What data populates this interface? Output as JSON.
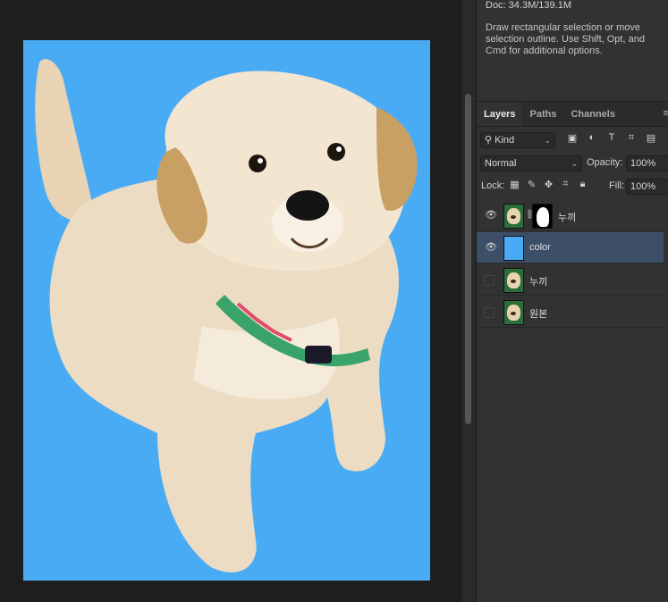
{
  "info": {
    "doc_size": "Doc: 34.3M/139.1M",
    "hint": "Draw rectangular selection or move selection outline.  Use Shift, Opt, and Cmd for additional options."
  },
  "layers_panel": {
    "tabs": [
      "Layers",
      "Paths",
      "Channels"
    ],
    "menu_icon": "≡",
    "filter": {
      "label": "Kind",
      "icons": [
        "image-filter-icon",
        "adjustment-filter-icon",
        "type-filter-icon",
        "shape-filter-icon",
        "smart-object-filter-icon"
      ]
    },
    "blend_mode": "Normal",
    "opacity_label": "Opacity:",
    "opacity_value": "100%",
    "lock_label": "Lock:",
    "fill_label": "Fill:",
    "fill_value": "100%",
    "layers": [
      {
        "name": "누끼",
        "visible": true,
        "has_mask": true,
        "selected": false,
        "thumb": "photo"
      },
      {
        "name": "color",
        "visible": true,
        "has_mask": false,
        "selected": true,
        "thumb": "color"
      },
      {
        "name": "누끼",
        "visible": false,
        "has_mask": false,
        "selected": false,
        "thumb": "photo"
      },
      {
        "name": "원본",
        "visible": false,
        "has_mask": false,
        "selected": false,
        "thumb": "photo"
      }
    ]
  },
  "canvas": {
    "background_color": "#4aabf5",
    "subject": "cutout-puppy"
  }
}
